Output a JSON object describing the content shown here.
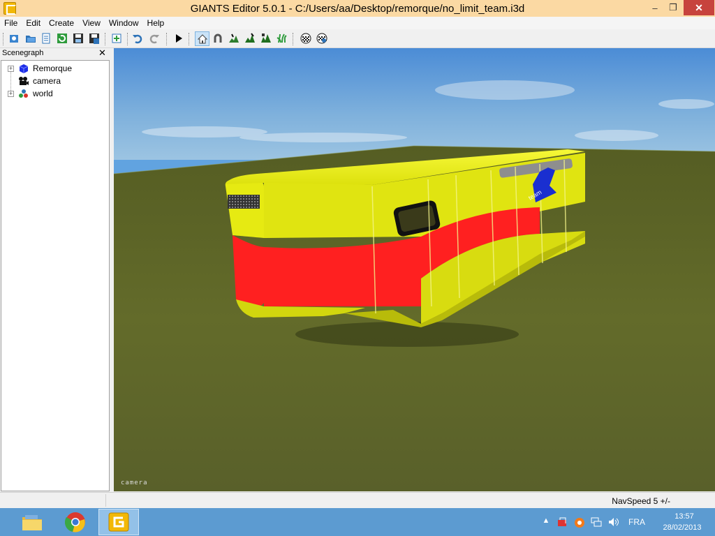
{
  "window": {
    "title": "GIANTS Editor 5.0.1 - C:/Users/aa/Desktop/remorque/no_limit_team.i3d",
    "minimize_glyph": "–",
    "maximize_glyph": "❐",
    "close_glyph": "✕"
  },
  "menu": {
    "items": [
      {
        "label": "File"
      },
      {
        "label": "Edit"
      },
      {
        "label": "Create"
      },
      {
        "label": "View"
      },
      {
        "label": "Window"
      },
      {
        "label": "Help"
      }
    ]
  },
  "toolbar": {
    "icons": [
      "new-scene-icon",
      "open-icon",
      "properties-icon",
      "refresh-icon",
      "save-icon",
      "save-all-icon",
      "import-icon",
      "undo-icon",
      "redo-icon",
      "play-icon",
      "home-icon",
      "magnet-icon",
      "terrain-sculpt-icon",
      "terrain-paint-icon",
      "terrain-detail-icon",
      "foliage-icon",
      "shader-icon",
      "material-icon"
    ],
    "active": "home-icon"
  },
  "scenegraph": {
    "title": "Scenegraph",
    "close_glyph": "✕",
    "nodes": [
      {
        "label": "Remorque",
        "icon": "cube-icon",
        "expandable": true
      },
      {
        "label": "camera",
        "icon": "camera-icon",
        "expandable": false
      },
      {
        "label": "world",
        "icon": "transform-group-icon",
        "expandable": true
      }
    ]
  },
  "viewport": {
    "camera_label": "camera",
    "colors": {
      "sky": "#5f9fdc",
      "ground": "#5f6a24",
      "trailer_body": "#e6ea12",
      "trailer_stripe": "#ff2020"
    }
  },
  "statusbar": {
    "navspeed": "NavSpeed 5 +/-"
  },
  "taskbar": {
    "apps": [
      "file-explorer-icon",
      "chrome-icon",
      "giants-editor-icon"
    ],
    "active": "giants-editor-icon",
    "tray": {
      "language": "FRA",
      "time": "13:57",
      "date": "28/02/2013"
    }
  }
}
